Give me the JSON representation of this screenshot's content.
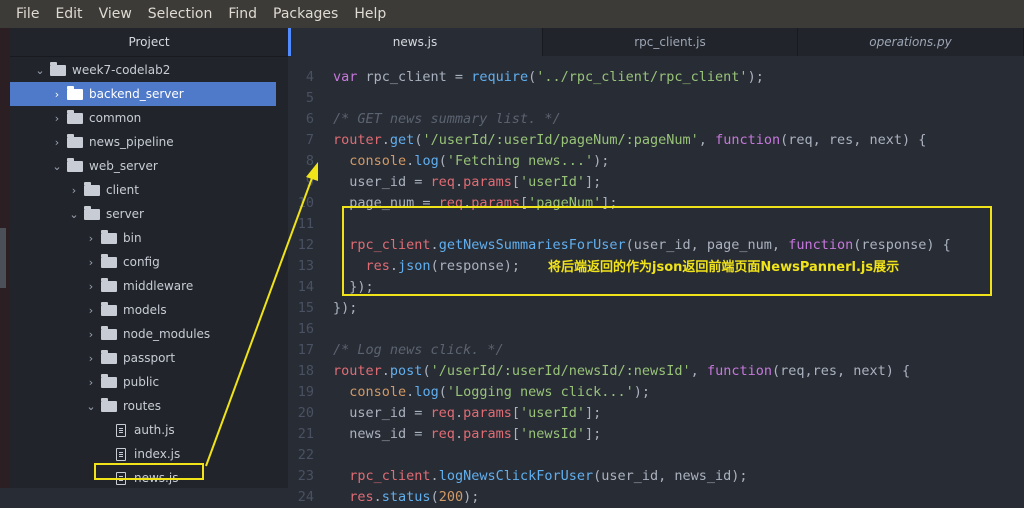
{
  "menu": [
    "File",
    "Edit",
    "View",
    "Selection",
    "Find",
    "Packages",
    "Help"
  ],
  "tree": {
    "header": "Project",
    "items": [
      {
        "label": "week7-codelab2",
        "kind": "folder",
        "depth": 0,
        "expanded": true,
        "selected": false
      },
      {
        "label": "backend_server",
        "kind": "folder",
        "depth": 1,
        "expanded": false,
        "selected": true
      },
      {
        "label": "common",
        "kind": "folder",
        "depth": 1,
        "expanded": false,
        "selected": false
      },
      {
        "label": "news_pipeline",
        "kind": "folder",
        "depth": 1,
        "expanded": false,
        "selected": false
      },
      {
        "label": "web_server",
        "kind": "folder",
        "depth": 1,
        "expanded": true,
        "selected": false
      },
      {
        "label": "client",
        "kind": "folder",
        "depth": 2,
        "expanded": false,
        "selected": false
      },
      {
        "label": "server",
        "kind": "folder",
        "depth": 2,
        "expanded": true,
        "selected": false
      },
      {
        "label": "bin",
        "kind": "folder",
        "depth": 3,
        "expanded": false,
        "selected": false
      },
      {
        "label": "config",
        "kind": "folder",
        "depth": 3,
        "expanded": false,
        "selected": false
      },
      {
        "label": "middleware",
        "kind": "folder",
        "depth": 3,
        "expanded": false,
        "selected": false
      },
      {
        "label": "models",
        "kind": "folder",
        "depth": 3,
        "expanded": false,
        "selected": false
      },
      {
        "label": "node_modules",
        "kind": "folder",
        "depth": 3,
        "expanded": false,
        "selected": false
      },
      {
        "label": "passport",
        "kind": "folder",
        "depth": 3,
        "expanded": false,
        "selected": false
      },
      {
        "label": "public",
        "kind": "folder",
        "depth": 3,
        "expanded": false,
        "selected": false
      },
      {
        "label": "routes",
        "kind": "folder",
        "depth": 3,
        "expanded": true,
        "selected": false
      },
      {
        "label": "auth.js",
        "kind": "file",
        "depth": 4,
        "expanded": false,
        "selected": false
      },
      {
        "label": "index.js",
        "kind": "file",
        "depth": 4,
        "expanded": false,
        "selected": false
      },
      {
        "label": "news.js",
        "kind": "file",
        "depth": 4,
        "expanded": false,
        "selected": false
      }
    ]
  },
  "tabs": [
    {
      "label": "news.js",
      "active": true,
      "italic": false
    },
    {
      "label": "rpc_client.js",
      "active": false,
      "italic": false
    },
    {
      "label": "operations.py",
      "active": false,
      "italic": true
    }
  ],
  "code": [
    {
      "n": "4",
      "tokens": [
        [
          "kw",
          "var"
        ],
        [
          "plain",
          " rpc_client = "
        ],
        [
          "fn",
          "require"
        ],
        [
          "plain",
          "("
        ],
        [
          "str",
          "'../rpc_client/rpc_client'"
        ],
        [
          "plain",
          ");"
        ]
      ]
    },
    {
      "n": "5",
      "tokens": []
    },
    {
      "n": "6",
      "tokens": [
        [
          "com",
          "/* GET news summary list. */"
        ]
      ]
    },
    {
      "n": "7",
      "tokens": [
        [
          "var",
          "router"
        ],
        [
          "plain",
          "."
        ],
        [
          "fn",
          "get"
        ],
        [
          "plain",
          "("
        ],
        [
          "str",
          "'/userId/:userId/pageNum/:pageNum'"
        ],
        [
          "plain",
          ", "
        ],
        [
          "kw",
          "function"
        ],
        [
          "plain",
          "(req, res, next) {"
        ]
      ]
    },
    {
      "n": "8",
      "tokens": [
        [
          "plain",
          "  "
        ],
        [
          "num",
          "console"
        ],
        [
          "plain",
          "."
        ],
        [
          "fn",
          "log"
        ],
        [
          "plain",
          "("
        ],
        [
          "str",
          "'Fetching news...'"
        ],
        [
          "plain",
          ");"
        ]
      ]
    },
    {
      "n": "9",
      "tokens": [
        [
          "plain",
          "  user_id = "
        ],
        [
          "var",
          "req"
        ],
        [
          "plain",
          "."
        ],
        [
          "var",
          "params"
        ],
        [
          "plain",
          "["
        ],
        [
          "str",
          "'userId'"
        ],
        [
          "plain",
          "];"
        ]
      ]
    },
    {
      "n": "10",
      "tokens": [
        [
          "plain",
          "  page_num = "
        ],
        [
          "var",
          "req"
        ],
        [
          "plain",
          "."
        ],
        [
          "var",
          "params"
        ],
        [
          "plain",
          "["
        ],
        [
          "str",
          "'pageNum'"
        ],
        [
          "plain",
          "];"
        ]
      ]
    },
    {
      "n": "11",
      "tokens": []
    },
    {
      "n": "12",
      "tokens": [
        [
          "plain",
          "  "
        ],
        [
          "var",
          "rpc_client"
        ],
        [
          "plain",
          "."
        ],
        [
          "fn",
          "getNewsSummariesForUser"
        ],
        [
          "plain",
          "(user_id, page_num, "
        ],
        [
          "kw",
          "function"
        ],
        [
          "plain",
          "(response) {"
        ]
      ]
    },
    {
      "n": "13",
      "tokens": [
        [
          "plain",
          "    "
        ],
        [
          "var",
          "res"
        ],
        [
          "plain",
          "."
        ],
        [
          "fn",
          "json"
        ],
        [
          "plain",
          "(response);"
        ]
      ]
    },
    {
      "n": "14",
      "tokens": [
        [
          "plain",
          "  });"
        ]
      ]
    },
    {
      "n": "15",
      "tokens": [
        [
          "plain",
          "});"
        ]
      ]
    },
    {
      "n": "16",
      "tokens": []
    },
    {
      "n": "17",
      "tokens": [
        [
          "com",
          "/* Log news click. */"
        ]
      ]
    },
    {
      "n": "18",
      "tokens": [
        [
          "var",
          "router"
        ],
        [
          "plain",
          "."
        ],
        [
          "fn",
          "post"
        ],
        [
          "plain",
          "("
        ],
        [
          "str",
          "'/userId/:userId/newsId/:newsId'"
        ],
        [
          "plain",
          ", "
        ],
        [
          "kw",
          "function"
        ],
        [
          "plain",
          "(req,res, next) {"
        ]
      ]
    },
    {
      "n": "19",
      "tokens": [
        [
          "plain",
          "  "
        ],
        [
          "num",
          "console"
        ],
        [
          "plain",
          "."
        ],
        [
          "fn",
          "log"
        ],
        [
          "plain",
          "("
        ],
        [
          "str",
          "'Logging news click...'"
        ],
        [
          "plain",
          ");"
        ]
      ]
    },
    {
      "n": "20",
      "tokens": [
        [
          "plain",
          "  user_id = "
        ],
        [
          "var",
          "req"
        ],
        [
          "plain",
          "."
        ],
        [
          "var",
          "params"
        ],
        [
          "plain",
          "["
        ],
        [
          "str",
          "'userId'"
        ],
        [
          "plain",
          "];"
        ]
      ]
    },
    {
      "n": "21",
      "tokens": [
        [
          "plain",
          "  news_id = "
        ],
        [
          "var",
          "req"
        ],
        [
          "plain",
          "."
        ],
        [
          "var",
          "params"
        ],
        [
          "plain",
          "["
        ],
        [
          "str",
          "'newsId'"
        ],
        [
          "plain",
          "];"
        ]
      ]
    },
    {
      "n": "22",
      "tokens": []
    },
    {
      "n": "23",
      "tokens": [
        [
          "plain",
          "  "
        ],
        [
          "var",
          "rpc_client"
        ],
        [
          "plain",
          "."
        ],
        [
          "fn",
          "logNewsClickForUser"
        ],
        [
          "plain",
          "(user_id, news_id);"
        ]
      ]
    },
    {
      "n": "24",
      "tokens": [
        [
          "plain",
          "  "
        ],
        [
          "var",
          "res"
        ],
        [
          "plain",
          "."
        ],
        [
          "fn",
          "status"
        ],
        [
          "plain",
          "("
        ],
        [
          "num",
          "200"
        ],
        [
          "plain",
          ");"
        ]
      ]
    }
  ],
  "annotation": {
    "text": "将后端返回的作为json返回前端页面NewsPannerl.js展示",
    "color": "#f0e31a"
  }
}
